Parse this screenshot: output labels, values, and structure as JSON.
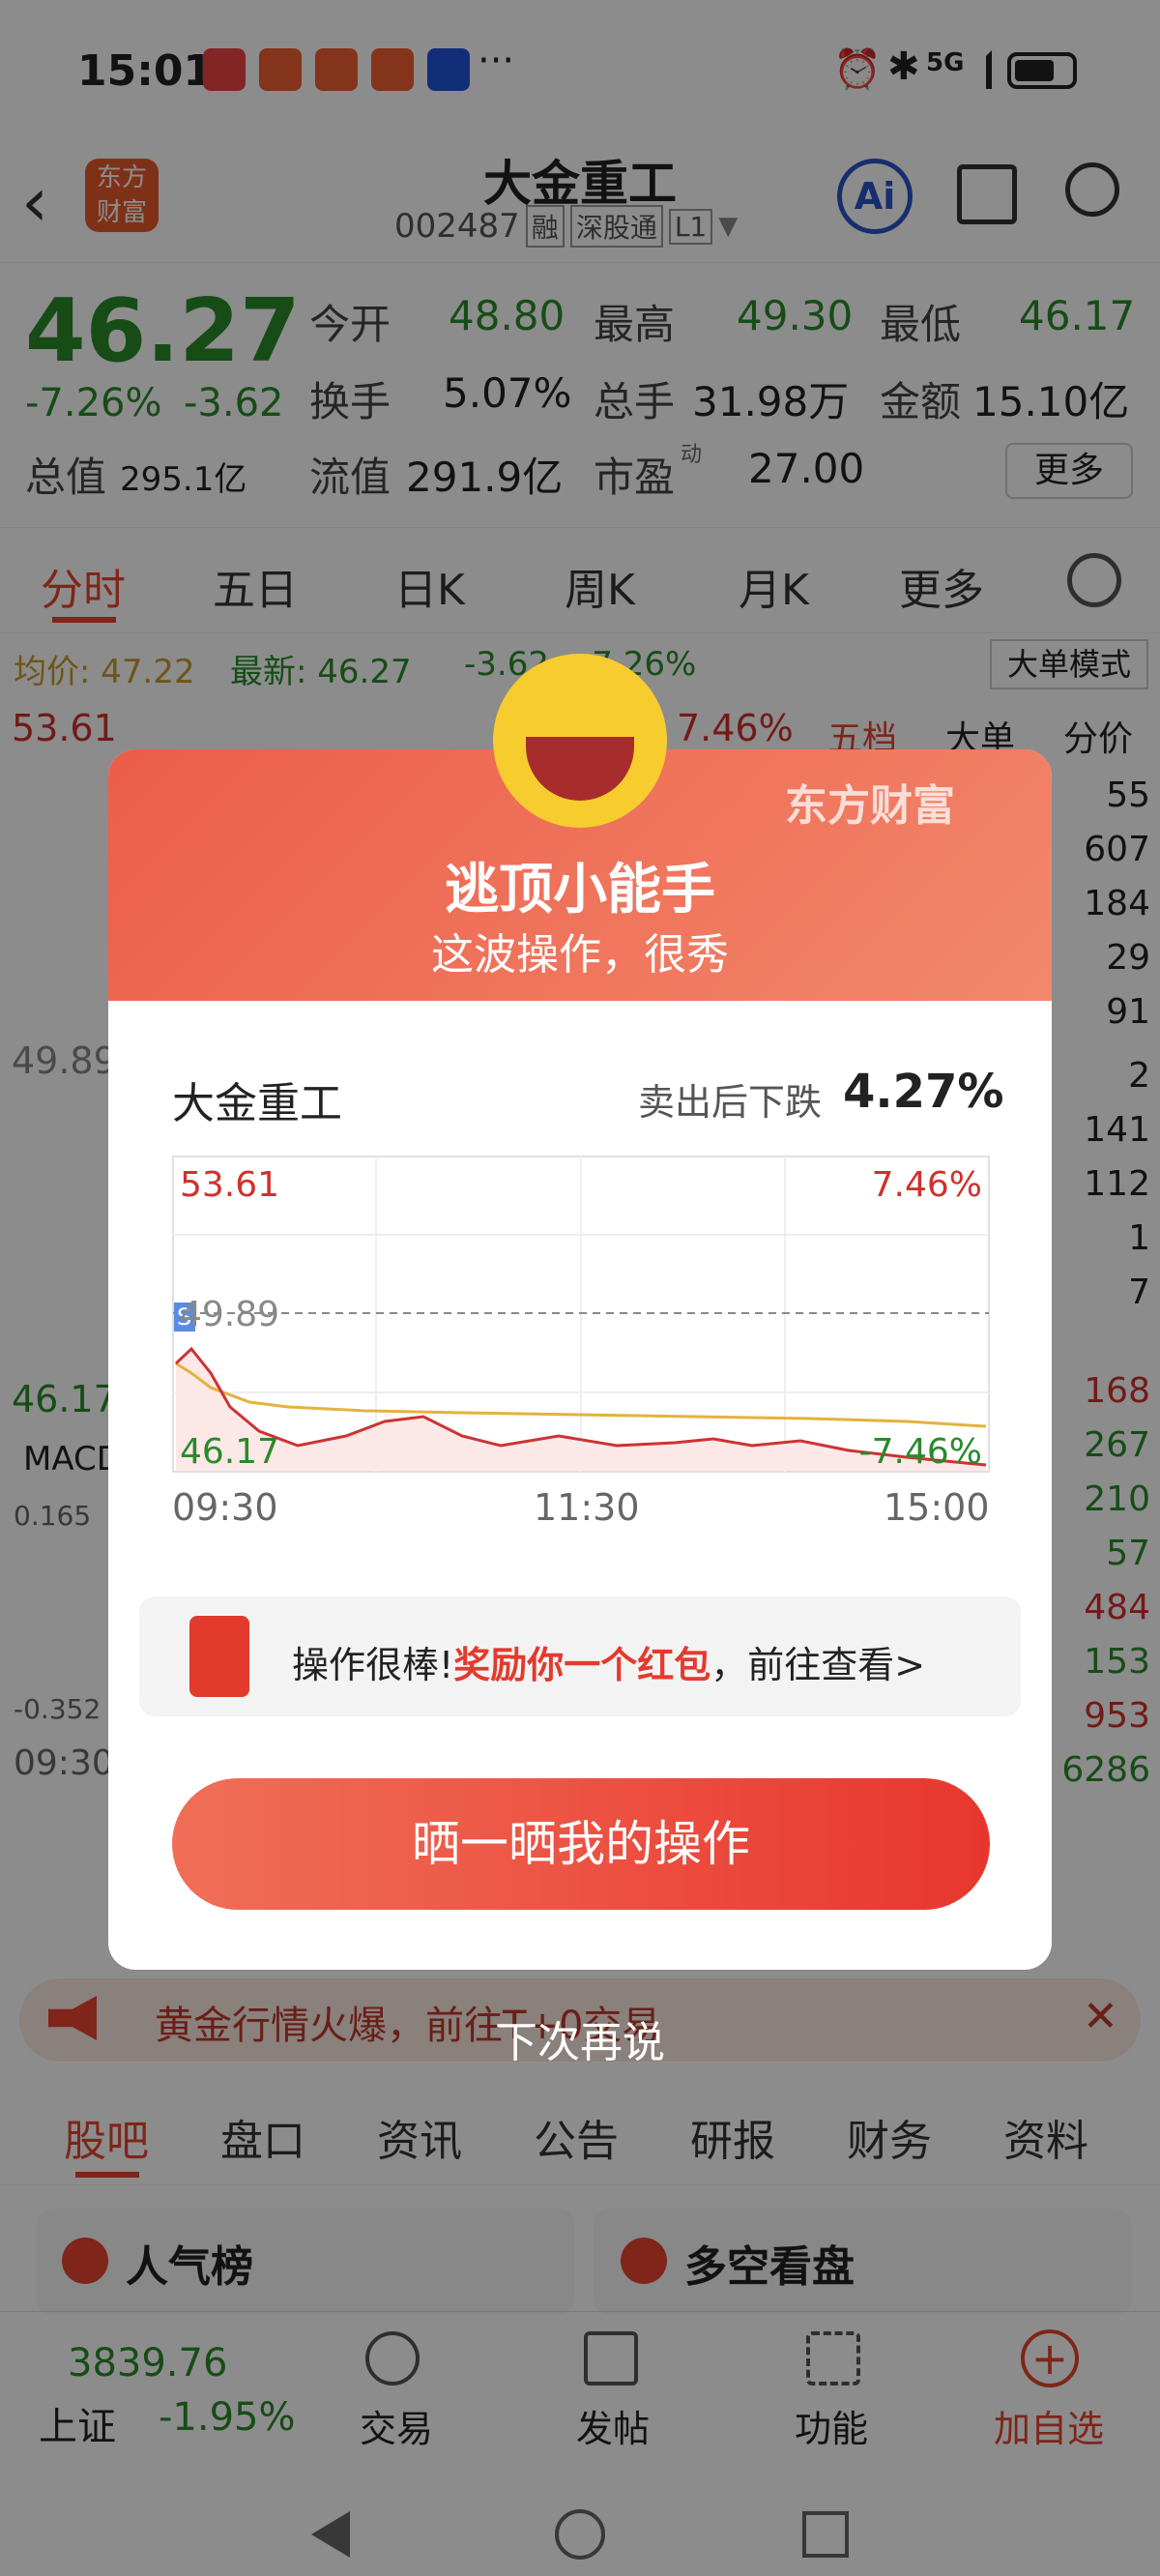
{
  "status_bar": {
    "time": "15:01",
    "network": "5G"
  },
  "header": {
    "title": "大金重工",
    "code": "002487",
    "badges": [
      "融",
      "深股通",
      "L1"
    ],
    "ai_label": "Ai",
    "logo_text": "东方财富"
  },
  "quote": {
    "price": "46.27",
    "change_pct": "-7.26%",
    "change": "-3.62",
    "open_label": "今开",
    "open": "48.80",
    "high_label": "最高",
    "high": "49.30",
    "low_label": "最低",
    "low": "46.17",
    "turnover_label": "换手",
    "turnover": "5.07%",
    "volume_label": "总手",
    "volume": "31.98万",
    "amount_label": "金额",
    "amount": "15.10亿",
    "mktcap_label": "总值",
    "mktcap": "295.1亿",
    "float_label": "流值",
    "float": "291.9亿",
    "pe_label": "市盈",
    "pe_sup": "动",
    "pe": "27.00",
    "more": "更多"
  },
  "ktabs": [
    "分时",
    "五日",
    "日K",
    "周K",
    "月K",
    "更多"
  ],
  "chart_info": {
    "avg": "均价: 47.22",
    "latest": "最新: 46.27",
    "chg": "-3.62",
    "pct": "-7.26%",
    "mode": "大单模式",
    "high": "53.61",
    "high_pct": "7.46%",
    "mid": "49.89",
    "low": "46.17",
    "macd": "MACD",
    "macd_hi": "0.165",
    "macd_lo": "-0.352",
    "time_start": "09:30",
    "side_tabs": [
      "五档",
      "大单",
      "分价"
    ],
    "side_top": [
      "55",
      "607",
      "184",
      "29",
      "91"
    ],
    "side_mid": [
      "2",
      "141",
      "112",
      "1",
      "7"
    ],
    "side_low": [
      "168",
      "267",
      "210",
      "57",
      "484",
      "153",
      "953",
      "6286"
    ]
  },
  "notice": {
    "text": "黄金行情火爆，前往T+0交易"
  },
  "news_tabs": [
    "股吧",
    "盘口",
    "资讯",
    "公告",
    "研报",
    "财务",
    "资料"
  ],
  "cards": [
    {
      "label": "人气榜"
    },
    {
      "label": "多空看盘"
    }
  ],
  "bottom_nav": {
    "index_value": "3839.76",
    "index_name": "上证",
    "index_pct": "-1.95%",
    "items": [
      "交易",
      "发帖",
      "功能",
      "加自选"
    ]
  },
  "modal": {
    "brand": "东方财富",
    "title": "逃顶小能手",
    "subtitle": "这波操作，很秀",
    "stock_name": "大金重工",
    "drop_label": "卖出后下跌",
    "drop_value": "4.27%",
    "chart_high": "53.61",
    "chart_high_pct": "7.46%",
    "chart_mid": "49.89",
    "chart_low": "46.17",
    "chart_low_pct": "-7.46%",
    "times": [
      "09:30",
      "11:30",
      "15:00"
    ],
    "s_marker": "S",
    "reward_prefix": "操作很棒!",
    "reward_highlight": "奖励你一个红包",
    "reward_suffix": "，前往查看>",
    "share_button": "晒一晒我的操作",
    "skip": "下次再说"
  },
  "colors": {
    "up": "#d0312d",
    "down": "#2a8a2a",
    "accent": "#e8442e",
    "modal_head": "#ec5d49"
  }
}
